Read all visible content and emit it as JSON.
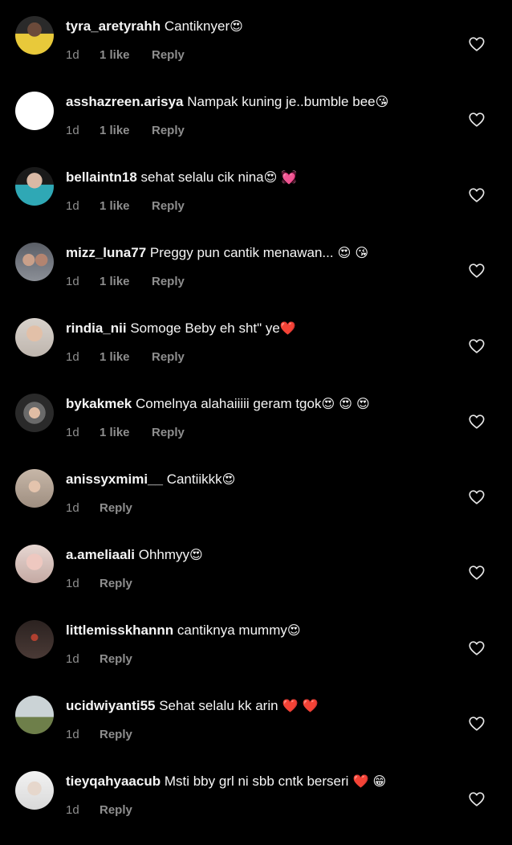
{
  "comments": [
    {
      "username": "tyra_aretyrahh",
      "text": "Cantiknyer",
      "emoji": "😍",
      "time": "1d",
      "likes": "1 like",
      "reply": "Reply",
      "avatar": "yellow"
    },
    {
      "username": "asshazreen.arisya",
      "text": "Nampak kuning je..bumble bee",
      "emoji": "😘",
      "time": "1d",
      "likes": "1 like",
      "reply": "Reply",
      "avatar": "blank"
    },
    {
      "username": "bellaintn18",
      "text": "sehat selalu cik nina",
      "emoji": "😍 💓",
      "time": "1d",
      "likes": "1 like",
      "reply": "Reply",
      "avatar": "teal"
    },
    {
      "username": "mizz_luna77",
      "text": "Preggy pun cantik menawan...",
      "emoji": " 😍 😘",
      "time": "1d",
      "likes": "1 like",
      "reply": "Reply",
      "avatar": "group"
    },
    {
      "username": "rindia_nii",
      "text": "Somoge Beby eh sht\" ye",
      "emoji": "❤️",
      "time": "1d",
      "likes": "1 like",
      "reply": "Reply",
      "avatar": "light"
    },
    {
      "username": "bykakmek",
      "text": "Comelnya alahaiiiii geram tgok",
      "emoji": "😍 😍 😍",
      "time": "1d",
      "likes": "1 like",
      "reply": "Reply",
      "avatar": "hijab"
    },
    {
      "username": "anissyxmimi__",
      "text": "Cantiikkk",
      "emoji": "😍",
      "time": "1d",
      "likes": "",
      "reply": "Reply",
      "avatar": "hijab2"
    },
    {
      "username": "a.ameliaali",
      "text": "Ohhmyy",
      "emoji": "😍",
      "time": "1d",
      "likes": "",
      "reply": "Reply",
      "avatar": "pink"
    },
    {
      "username": "littlemisskhannn",
      "text": "cantiknya mummy",
      "emoji": "😍",
      "time": "1d",
      "likes": "",
      "reply": "Reply",
      "avatar": "dark"
    },
    {
      "username": "ucidwiyanti55",
      "text": "Sehat selalu kk arin",
      "emoji": " ❤️ ❤️",
      "time": "1d",
      "likes": "",
      "reply": "Reply",
      "avatar": "outdoor"
    },
    {
      "username": "tieyqahyaacub",
      "text": "Msti bby grl ni sbb cntk berseri",
      "emoji": " ❤️  😁",
      "time": "1d",
      "likes": "",
      "reply": "Reply",
      "avatar": "white"
    }
  ],
  "colors": {
    "background": "#000000",
    "text": "#f5f5f5",
    "secondary": "#8e8e8e"
  }
}
